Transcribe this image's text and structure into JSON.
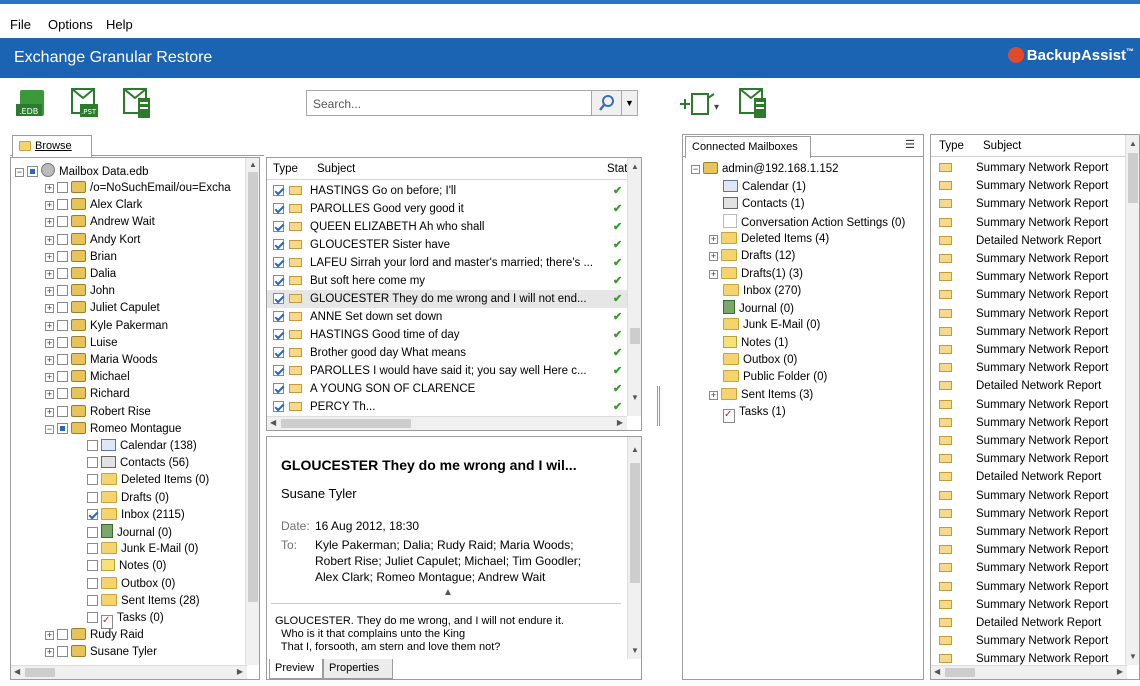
{
  "menu": [
    "File",
    "Options",
    "Help"
  ],
  "app_title": "Exchange Granular Restore",
  "brand": "BackupAssist",
  "brand_mark": "™",
  "toolbar": {
    "edb_label": ".EDB",
    "pst_label": ".PST",
    "search_placeholder": "Search..."
  },
  "browse_tab": "Browse",
  "source_tree": {
    "root": "Mailbox Data.edb",
    "items": [
      "/o=NoSuchEmail/ou=Excha",
      "Alex Clark",
      "Andrew Wait",
      "Andy Kort",
      "Brian",
      "Dalia",
      "John",
      "Juliet Capulet",
      "Kyle Pakerman",
      "Luise",
      "Maria Woods",
      "Michael",
      "Richard",
      "Robert Rise",
      "Romeo Montague"
    ],
    "romeo_children": [
      "Calendar (138)",
      "Contacts (56)",
      "Deleted Items (0)",
      "Drafts (0)",
      "Inbox (2115)",
      "Journal (0)",
      "Junk E-Mail (0)",
      "Notes (0)",
      "Outbox (0)",
      "Sent Items (28)",
      "Tasks (0)"
    ],
    "after": [
      "Rudy Raid",
      "Susane Tyler"
    ]
  },
  "message_list": {
    "col_type": "Type",
    "col_subject": "Subject",
    "col_status": "Stat",
    "rows": [
      "HASTINGS Go on before; I'll",
      "PAROLLES Good very good it",
      "QUEEN ELIZABETH Ah who shall",
      "GLOUCESTER Sister have",
      "LAFEU Sirrah your lord and master's married; there's ...",
      "But soft here come my",
      "GLOUCESTER They do me wrong and I will not end...",
      "ANNE Set down set down",
      "HASTINGS Good time of day",
      "Brother good day What means",
      "PAROLLES I would have said it; you say well Here c...",
      "A YOUNG SON OF CLARENCE",
      "PERCY Th..."
    ]
  },
  "preview": {
    "subject": "GLOUCESTER They do me wrong and I wil...",
    "sender": "Susane Tyler",
    "date_label": "Date:",
    "date_value": "16 Aug 2012, 18:30",
    "to_label": "To:",
    "to_line1": "Kyle Pakerman; Dalia; Rudy Raid; Maria Woods;",
    "to_line2": "Robert Rise; Juliet Capulet; Michael; Tim Goodler;",
    "to_line3": "Alex Clark; Romeo Montague; Andrew Wait",
    "body_line1": "GLOUCESTER. They do me wrong, and I will not endure it.",
    "body_line2": "  Who is it that complains unto the King",
    "body_line3": "  That I, forsooth, am stern and love them not?",
    "tab_preview": "Preview",
    "tab_properties": "Properties"
  },
  "connected": {
    "tab": "Connected Mailboxes",
    "root": "admin@192.168.1.152",
    "items": [
      "Calendar (1)",
      "Contacts (1)",
      "Conversation Action Settings (0)",
      "Deleted Items (4)",
      "Drafts (12)",
      "Drafts(1) (3)",
      "Inbox (270)",
      "Journal (0)",
      "Junk E-Mail (0)",
      "Notes (1)",
      "Outbox (0)",
      "Public Folder (0)",
      "Sent Items (3)",
      "Tasks (1)"
    ]
  },
  "right_list": {
    "col_type": "Type",
    "col_subject": "Subject",
    "rows": [
      "Summary Network Report",
      "Summary Network Report",
      "Summary Network Report",
      "Summary Network Report",
      "Detailed Network Report",
      "Summary Network Report",
      "Summary Network Report",
      "Summary Network Report",
      "Summary Network Report",
      "Summary Network Report",
      "Summary Network Report",
      "Summary Network Report",
      "Detailed Network Report",
      "Summary Network Report",
      "Summary Network Report",
      "Summary Network Report",
      "Summary Network Report",
      "Detailed Network Report",
      "Summary Network Report",
      "Summary Network Report",
      "Summary Network Report",
      "Summary Network Report",
      "Summary Network Report",
      "Summary Network Report",
      "Summary Network Report",
      "Detailed Network Report",
      "Summary Network Report",
      "Summary Network Report"
    ]
  },
  "colors": {
    "banner": "#1b63b3",
    "accent": "#2a66c6"
  }
}
